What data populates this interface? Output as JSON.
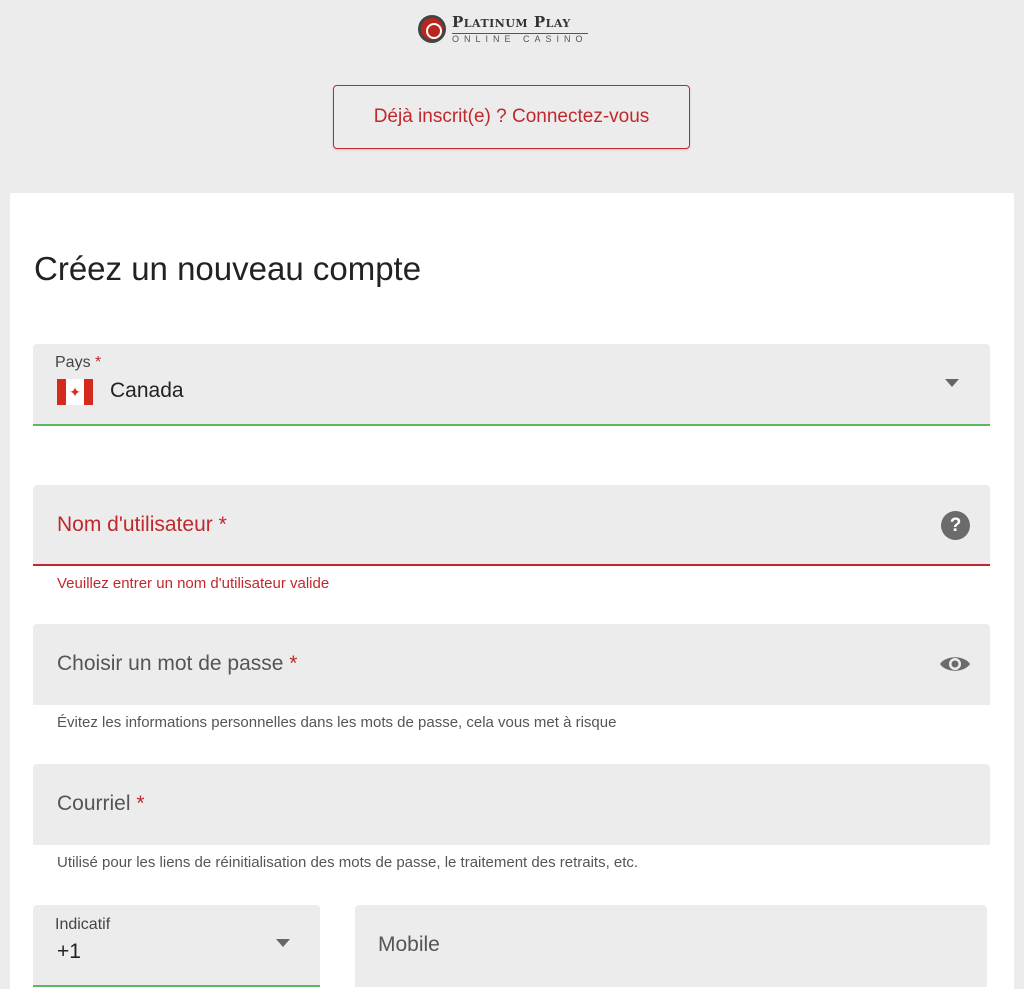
{
  "logo": {
    "line1": "Platinum Play",
    "line2": "ONLINE CASINO"
  },
  "login_button": "Déjà inscrit(e) ? Connectez-vous",
  "form": {
    "title": "Créez un nouveau compte",
    "country": {
      "label": "Pays",
      "required": "*",
      "value": "Canada",
      "icon": "canada-flag-icon"
    },
    "username": {
      "label": "Nom d'utilisateur",
      "required": "*",
      "error": "Veuillez entrer un nom d'utilisateur valide",
      "icon": "help-icon"
    },
    "password": {
      "label": "Choisir un mot de passe",
      "required": "*",
      "hint": "Évitez les informations personnelles dans les mots de passe, cela vous met à risque",
      "icon": "eye-icon"
    },
    "email": {
      "label": "Courriel",
      "required": "*",
      "hint": "Utilisé pour les liens de réinitialisation des mots de passe, le traitement des retraits, etc."
    },
    "dial_code": {
      "label": "Indicatif",
      "value": "+1"
    },
    "mobile": {
      "label": "Mobile"
    }
  },
  "colors": {
    "accent_red": "#c0282d",
    "valid_green": "#5cb85c",
    "field_bg": "#ececec"
  }
}
